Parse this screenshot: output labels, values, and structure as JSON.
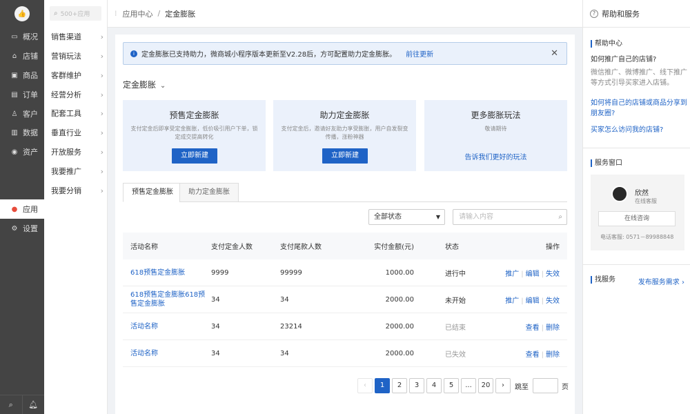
{
  "rail": {
    "logo_icon": "thumbs-up-icon",
    "items": [
      {
        "label": "概况",
        "icon": "monitor-icon"
      },
      {
        "label": "店铺",
        "icon": "store-icon"
      },
      {
        "label": "商品",
        "icon": "box-icon"
      },
      {
        "label": "订单",
        "icon": "document-icon"
      },
      {
        "label": "客户",
        "icon": "user-icon"
      },
      {
        "label": "数据",
        "icon": "bar-chart-icon"
      },
      {
        "label": "资产",
        "icon": "wallet-icon"
      },
      {
        "label": "应用",
        "icon": "apps-icon",
        "active": true
      },
      {
        "label": "设置",
        "icon": "gear-icon"
      }
    ]
  },
  "subnav": {
    "search_placeholder": "500+应用",
    "items": [
      "销售渠道",
      "营销玩法",
      "客群维护",
      "经营分析",
      "配套工具",
      "垂直行业",
      "开放服务",
      "我要推广",
      "我要分销"
    ]
  },
  "breadcrumb": {
    "parent": "应用中心",
    "current": "定金膨胀"
  },
  "notice": {
    "text": "定金膨胀已支持助力，微商城小程序版本更新至V2.28后，方可配置助力定金膨胀。",
    "link": "前往更新"
  },
  "section_title": "定金膨胀",
  "cards": [
    {
      "title": "预售定金膨胀",
      "desc": "支付定金后即享受定金膨胀，低价吸引用户下单，锁定成交提高转化",
      "button": "立即新建"
    },
    {
      "title": "助力定金膨胀",
      "desc": "支付定金后，邀请好友助力享受膨胀，用户自发裂变传播，涨粉神器",
      "button": "立即新建"
    },
    {
      "title": "更多膨胀玩法",
      "desc": "敬请期待",
      "link": "告诉我们更好的玩法"
    }
  ],
  "tabs": [
    "预售定金膨胀",
    "助力定金膨胀"
  ],
  "filter": {
    "status_selected": "全部状态",
    "search_placeholder": "请输入内容"
  },
  "table": {
    "headers": [
      "活动名称",
      "支付定金人数",
      "支付尾款人数",
      "实付金额(元)",
      "状态",
      "操作"
    ],
    "rows": [
      {
        "name": "618预售定金膨胀",
        "deposit": "9999",
        "balance": "99999",
        "amount": "1000.00",
        "status": "进行中",
        "actions": [
          "推广",
          "编辑",
          "失效"
        ]
      },
      {
        "name": "618预售定金膨胀618预售定金膨胀",
        "deposit": "34",
        "balance": "34",
        "amount": "2000.00",
        "status": "未开始",
        "actions": [
          "推广",
          "编辑",
          "失效"
        ]
      },
      {
        "name": "活动名称",
        "deposit": "34",
        "balance": "23214",
        "amount": "2000.00",
        "status": "已结束",
        "actions": [
          "查看",
          "删除"
        ]
      },
      {
        "name": "活动名称",
        "deposit": "34",
        "balance": "34",
        "amount": "2000.00",
        "status": "已失效",
        "actions": [
          "查看",
          "删除"
        ]
      }
    ]
  },
  "pagination": {
    "pages": [
      "1",
      "2",
      "3",
      "4",
      "5",
      "...",
      "20"
    ],
    "current": "1",
    "jump_label": "跳至",
    "page_unit": "页"
  },
  "help": {
    "title": "帮助和服务",
    "center_title": "帮助中心",
    "q1": "如何推广自己的店铺?",
    "a1": "微信推广、微博推广、线下推广等方式引导买家进入店铺。",
    "link1": "如何将自己的店铺或商品分享到朋友圈?",
    "link2": "买家怎么访问我的店铺?",
    "service_title": "服务窗口",
    "agent_name": "欣然",
    "agent_role": "在线客服",
    "consult_button": "在线咨询",
    "phone": "电话客服:  0571－89988848",
    "find_service": "找服务",
    "publish": "发布服务需求"
  },
  "colors": {
    "accent": "#1f63c6",
    "rail_bg": "#444444",
    "card_bg": "#ebf1fb"
  }
}
